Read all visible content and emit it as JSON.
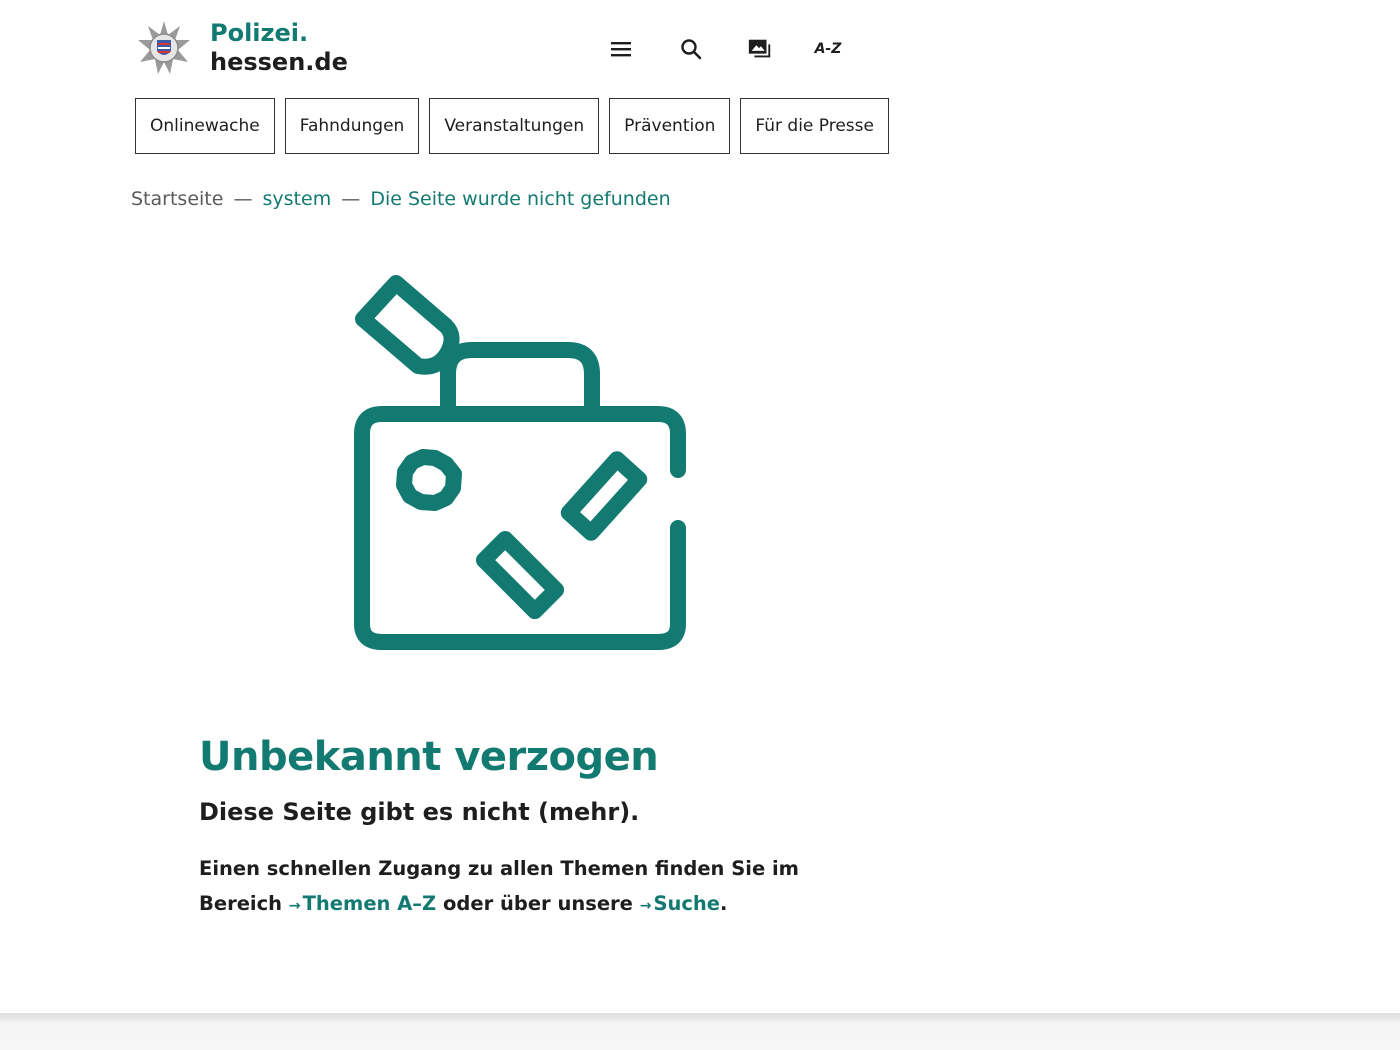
{
  "header": {
    "logo_line1": "Polizei.",
    "logo_line2": "hessen.de",
    "tools": {
      "menu_icon": "hamburger-menu-icon",
      "search_icon": "search-icon",
      "media_icon": "media-gallery-icon",
      "az_label": "A-Z"
    }
  },
  "nav": {
    "items": [
      {
        "label": "Onlinewache"
      },
      {
        "label": "Fahndungen"
      },
      {
        "label": "Veranstaltungen"
      },
      {
        "label": "Prävention"
      },
      {
        "label": "Für die Presse"
      }
    ]
  },
  "breadcrumb": {
    "items": [
      {
        "label": "Startseite"
      },
      {
        "label": "system"
      },
      {
        "label": "Die Seite wurde nicht gefunden"
      }
    ],
    "separator": "—"
  },
  "main": {
    "illustration": "suitcase-icon",
    "headline": "Unbekannt verzogen",
    "subline": "Diese Seite gibt es nicht (mehr).",
    "text_part1": "Einen schnellen Zugang zu allen Themen finden Sie im Bereich",
    "link_themen": "Themen A–Z",
    "text_part2": "oder über unsere",
    "link_suche": "Suche",
    "text_end": "."
  },
  "colors": {
    "brand_teal": "#137a72",
    "text_dark": "#1e1e1e",
    "breadcrumb_gray": "#5a5a5a"
  }
}
